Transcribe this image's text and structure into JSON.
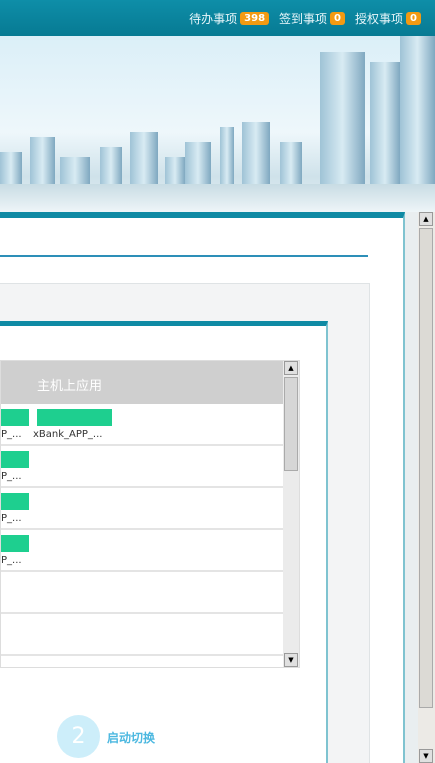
{
  "topbar": {
    "items": [
      {
        "label": "待办事项",
        "count": "398"
      },
      {
        "label": "签到事项",
        "count": "0"
      },
      {
        "label": "授权事项",
        "count": "0"
      }
    ]
  },
  "table": {
    "header": "主机上应用",
    "rows": [
      {
        "cells": [
          "P_...",
          "xBank_APP_..."
        ]
      },
      {
        "cells": [
          "P_..."
        ]
      },
      {
        "cells": [
          "P_..."
        ]
      },
      {
        "cells": [
          "P_..."
        ]
      }
    ]
  },
  "step": {
    "number": "2",
    "label": "启动切换"
  },
  "colors": {
    "accent": "#0f8aa4",
    "chip": "#1ecf8f",
    "badge": "#f39a12"
  }
}
